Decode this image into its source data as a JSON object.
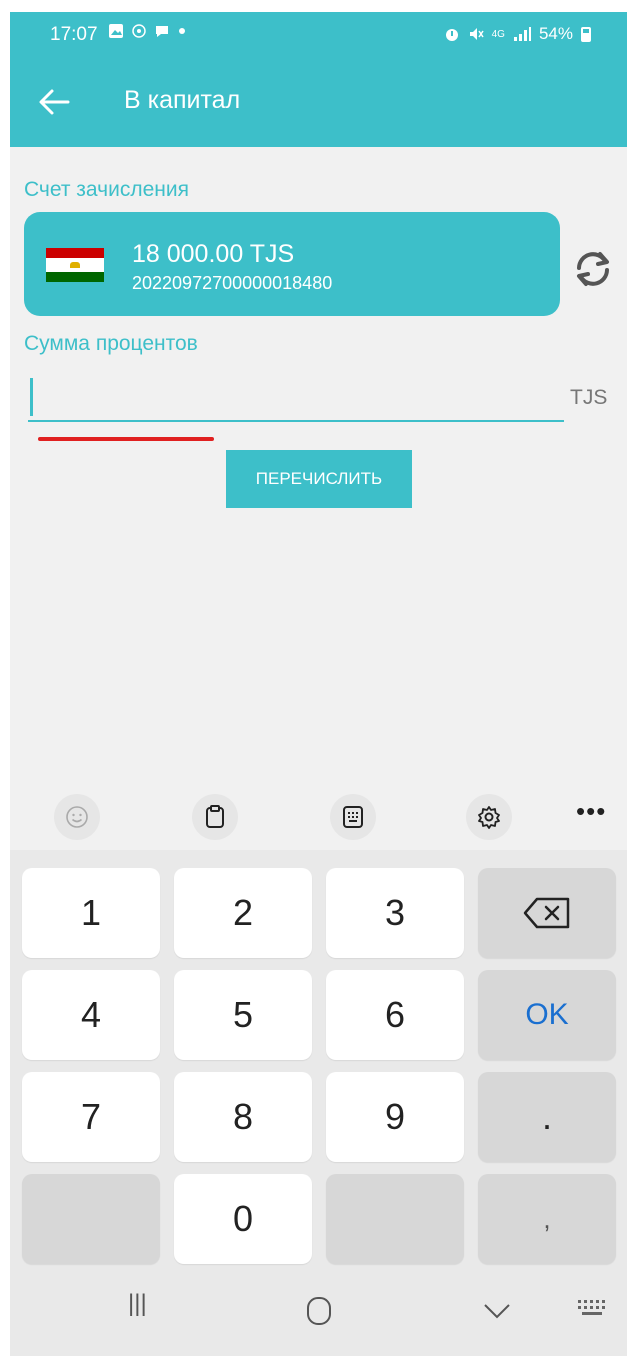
{
  "status_bar": {
    "time": "17:07",
    "signal_label": "4G",
    "battery": "54%"
  },
  "header": {
    "title": "В капитал",
    "back_icon": "arrow-left-icon"
  },
  "account": {
    "section_label": "Счет зачисления",
    "amount": "18 000.00 TJS",
    "number": "20220972700000018480",
    "flag_icon": "tajikistan-flag-icon",
    "refresh_icon": "refresh-icon"
  },
  "interest": {
    "label": "Сумма процентов",
    "value": "",
    "currency": "TJS"
  },
  "transfer_button": {
    "label": "ПЕРЕЧИСЛИТЬ"
  },
  "keyboard": {
    "toolbar_icons": [
      "emoji-icon",
      "clipboard-icon",
      "keyboard-layout-icon",
      "settings-icon",
      "more-icon"
    ],
    "more_label": "•••",
    "keys": {
      "k1": "1",
      "k2": "2",
      "k3": "3",
      "k4": "4",
      "k5": "5",
      "k6": "6",
      "k7": "7",
      "k8": "8",
      "k9": "9",
      "k0": "0",
      "ok": "OK",
      "dot": ".",
      "comma": ","
    }
  },
  "navbar": {
    "recents_label": "|||"
  },
  "colors": {
    "accent": "#3dbfc9",
    "underline_annotation": "#e02020",
    "ok_key": "#1a6fd0"
  }
}
